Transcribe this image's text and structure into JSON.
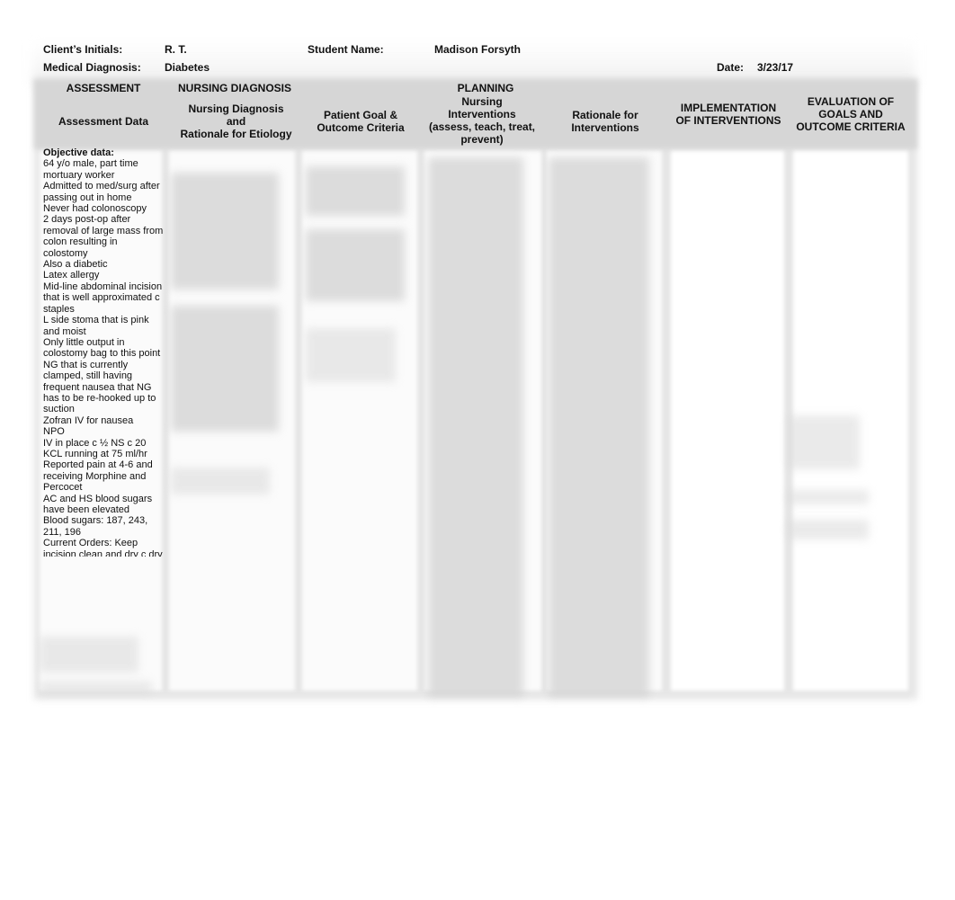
{
  "header": {
    "client_initials_label": "Client’s Initials:",
    "client_initials_value": "R. T.",
    "student_name_label": "Student Name:",
    "student_name_value": "Madison Forsyth",
    "medical_diagnosis_label": "Medical Diagnosis:",
    "medical_diagnosis_value": "Diabetes",
    "date_label": "Date:",
    "date_value": "3/23/17"
  },
  "table": {
    "section_headers": {
      "assessment": "ASSESSMENT",
      "nursing_diagnosis": "NURSING DIAGNOSIS",
      "planning": "PLANNING"
    },
    "columns": {
      "assessment_data": "Assessment Data",
      "nursing_diagnosis_l1": "Nursing Diagnosis",
      "nursing_diagnosis_l2": "and",
      "nursing_diagnosis_l3": "Rationale for Etiology",
      "patient_goal_l1": "Patient Goal &",
      "patient_goal_l2": "Outcome Criteria",
      "interventions_l1": "Nursing",
      "interventions_l2": "Interventions",
      "interventions_l3": "(assess, teach, treat,",
      "interventions_l4": "prevent)",
      "rationale_l1": "Rationale for",
      "rationale_l2": "Interventions",
      "implementation_l1": "IMPLEMENTATION",
      "implementation_l2": "OF INTERVENTIONS",
      "evaluation_l1": "EVALUATION OF",
      "evaluation_l2": "GOALS AND",
      "evaluation_l3": "OUTCOME CRITERIA"
    },
    "assessment_data": {
      "heading": "Objective data:",
      "lines": [
        "64 y/o male, part time",
        "mortuary worker",
        "Admitted to med/surg after",
        "passing out in home",
        "Never had colonoscopy",
        "2 days post-op after",
        "removal of large mass from",
        "colon resulting in",
        "colostomy",
        "Also a diabetic",
        "Latex allergy",
        "Mid-line abdominal incision",
        "that is well approximated c",
        "staples",
        "L side stoma that is pink",
        "and moist",
        "Only little output in",
        "colostomy bag to this point",
        "NG that is currently",
        "clamped, still having",
        "frequent nausea that NG",
        "has to be re-hooked up to",
        "suction",
        "Zofran IV for nausea",
        "NPO",
        "IV in place c ½  NS c 20",
        "KCL running at 75 ml/hr",
        "Reported pain at 4-6 and",
        "receiving Morphine and",
        "Percocet",
        "AC and HS blood sugars",
        "have been elevated",
        "Blood sugars: 187, 243,",
        "211, 196",
        "Current Orders: Keep",
        "incision clean and dry c dry"
      ]
    }
  }
}
